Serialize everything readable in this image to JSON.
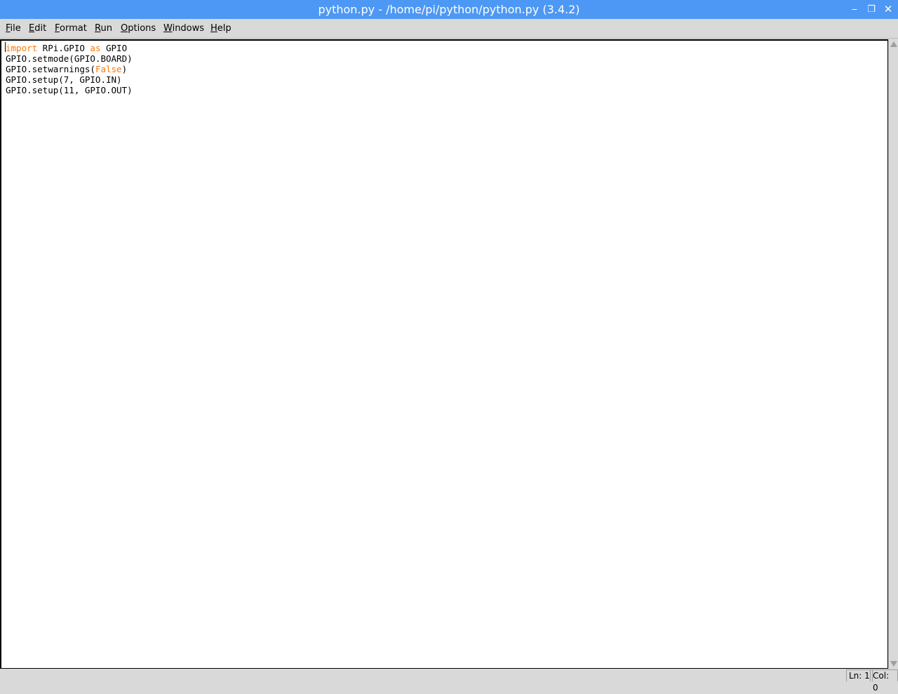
{
  "window": {
    "title": "python.py - /home/pi/python/python.py (3.4.2)",
    "controls": {
      "minimize": "‒",
      "maximize": "❐",
      "close": "✕"
    }
  },
  "menu": [
    {
      "mnemonic": "F",
      "rest": "ile"
    },
    {
      "mnemonic": "E",
      "rest": "dit"
    },
    {
      "mnemonic": "F",
      "rest": "ormat"
    },
    {
      "mnemonic": "R",
      "rest": "un"
    },
    {
      "mnemonic": "O",
      "rest": "ptions"
    },
    {
      "mnemonic": "W",
      "rest": "indows"
    },
    {
      "mnemonic": "H",
      "rest": "elp"
    }
  ],
  "editor": {
    "lines": [
      [
        {
          "text": "import",
          "kw": true
        },
        {
          "text": " RPi.GPIO "
        },
        {
          "text": "as",
          "kw": true
        },
        {
          "text": " GPIO"
        }
      ],
      [
        {
          "text": "GPIO.setmode(GPIO.BOARD)"
        }
      ],
      [
        {
          "text": "GPIO.setwarnings("
        },
        {
          "text": "False",
          "kw": true
        },
        {
          "text": ")"
        }
      ],
      [
        {
          "text": "GPIO.setup(7, GPIO.IN)"
        }
      ],
      [
        {
          "text": "GPIO.setup(11, GPIO.OUT)"
        }
      ]
    ],
    "keyword_color": "#ff7700"
  },
  "status": {
    "line": "Ln: 1",
    "column": "Col: 0"
  },
  "colors": {
    "titlebar": "#4d98f5",
    "chrome": "#d9d9d9",
    "editor_bg": "#ffffff"
  }
}
